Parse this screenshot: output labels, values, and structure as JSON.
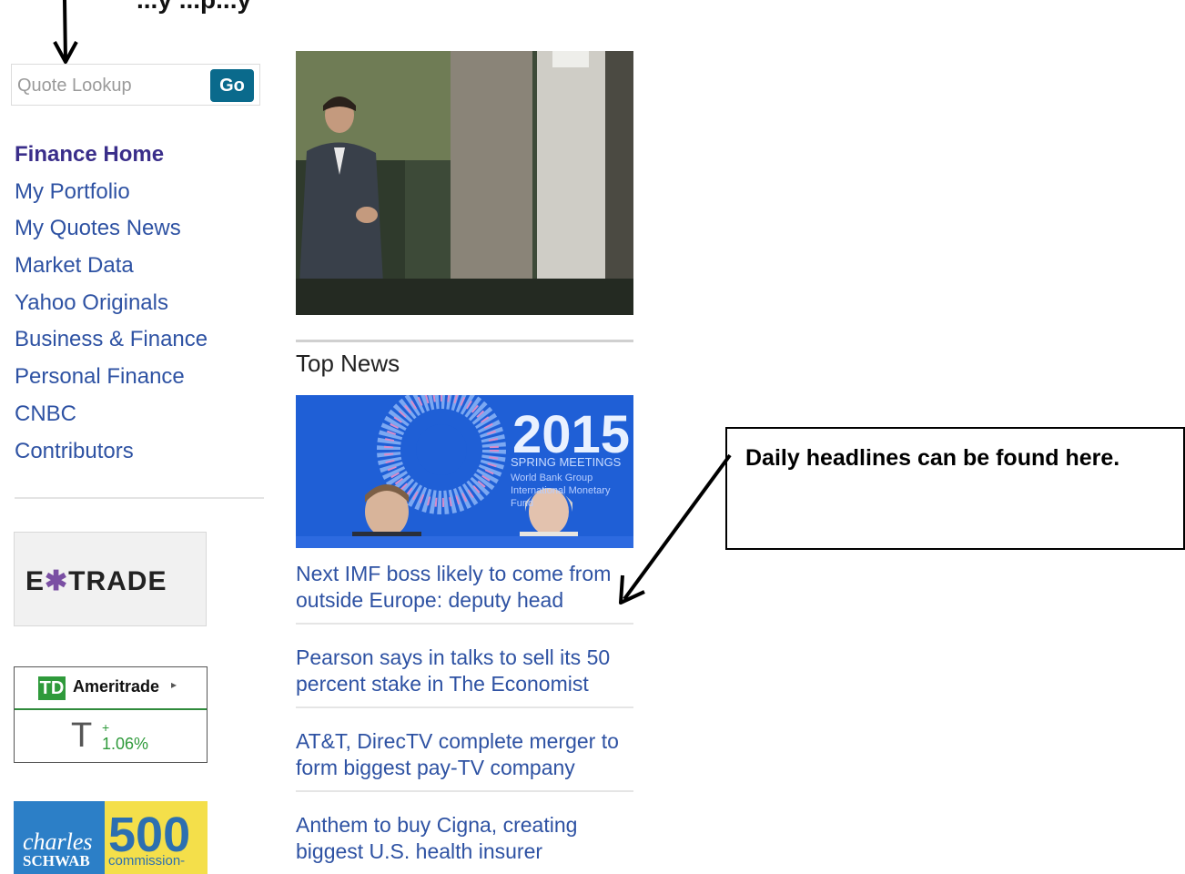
{
  "annotation_top": "...y                    ...p...y",
  "search": {
    "placeholder": "Quote Lookup",
    "button_label": "Go"
  },
  "nav": {
    "items": [
      {
        "label": "Finance Home",
        "active": true
      },
      {
        "label": "My Portfolio"
      },
      {
        "label": "My Quotes News"
      },
      {
        "label": "Market Data"
      },
      {
        "label": "Yahoo Originals"
      },
      {
        "label": "Business & Finance"
      },
      {
        "label": "Personal Finance"
      },
      {
        "label": "CNBC"
      },
      {
        "label": "Contributors"
      }
    ]
  },
  "ads": {
    "etrade": {
      "brand_left": "E",
      "brand_star": "✱",
      "brand_right": "TRADE"
    },
    "td": {
      "logo": "TD",
      "name": "Ameritrade",
      "arrow": "▸",
      "ticker": "T",
      "sign": "+",
      "change": "1.06%"
    },
    "schwab": {
      "script": "charles",
      "caps": "SCHWAB",
      "number": "500",
      "tagline": "commission-"
    }
  },
  "main": {
    "section_title": "Top News",
    "news_image": {
      "year": "2015",
      "caption": "SPRING MEETINGS",
      "org_line1": "World Bank Group",
      "org_line2": "International Monetary Fund"
    },
    "headlines": [
      {
        "line1": "Next IMF boss likely to come from",
        "line2": "outside Europe: deputy head"
      },
      {
        "line1": "Pearson says in talks to sell its 50",
        "line2": "percent stake in The Economist"
      },
      {
        "line1": "AT&T, DirecTV complete merger to",
        "line2": "form biggest pay-TV company"
      },
      {
        "line1": "Anthem to buy Cigna, creating",
        "line2": "biggest U.S. health insurer"
      }
    ]
  },
  "callout": {
    "text": "Daily headlines can be found here."
  },
  "colors": {
    "link": "#2e52a3",
    "go_button": "#0a6a8c",
    "td_green": "#2f9a3b"
  }
}
